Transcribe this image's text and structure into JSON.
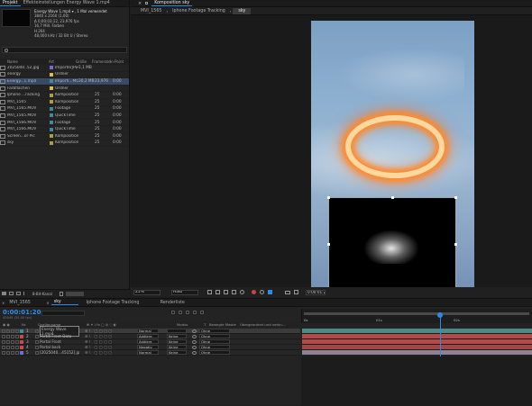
{
  "project": {
    "tabs": [
      "Projekt",
      "Effekteinstellungen Energy Wave 1.mp4"
    ],
    "selected_name": "Energy Wave 1.mp4 ▾ , 1 Mal verwendet",
    "info_lines": [
      "3840 x 2160 (1,00)",
      "Δ 0;00;03;12, 23,976 fps",
      "16,7 Mill. Farben",
      "H.264",
      "48,000 kHz / 32 Bit U / Stereo"
    ],
    "columns": {
      "name": "Name",
      "type": "Art",
      "size": "Größe",
      "fps": "Framerate",
      "in": "In-Point"
    },
    "items": [
      {
        "name": "2025040..52.jpg",
        "type": "ImporterJPEG",
        "size": "1,1 MB",
        "fps": "",
        "in": "",
        "color": "#7a6ad8",
        "sel": false
      },
      {
        "name": "energy",
        "type": "Ordner",
        "size": "",
        "fps": "",
        "in": "",
        "color": "#d8c23a",
        "sel": false
      },
      {
        "name": "Energy...1.mp4",
        "type": "Importi...MOV",
        "size": "30,2 MB",
        "fps": "23,976",
        "in": "0:00",
        "color": "#3f8a9a",
        "sel": true
      },
      {
        "name": "Farbflächen",
        "type": "Ordner",
        "size": "",
        "fps": "",
        "in": "",
        "color": "#d8c23a",
        "sel": false
      },
      {
        "name": "Iphone ...racking",
        "type": "Komposition",
        "size": "",
        "fps": "25",
        "in": "0:00",
        "color": "#a8a03a",
        "sel": false
      },
      {
        "name": "MVI_1565",
        "type": "Komposition",
        "size": "",
        "fps": "25",
        "in": "0:00",
        "color": "#a8a03a",
        "sel": false
      },
      {
        "name": "MVI_1565.MOV",
        "type": "Footage",
        "size": "",
        "fps": "25",
        "in": "0:00",
        "color": "#3f8a9a",
        "sel": false
      },
      {
        "name": "MVI_1565.MOV",
        "type": "QuickTime",
        "size": "",
        "fps": "25",
        "in": "0:00",
        "color": "#3f8a9a",
        "sel": false
      },
      {
        "name": "MVI_1566.MOV",
        "type": "Footage",
        "size": "",
        "fps": "25",
        "in": "0:00",
        "color": "#3f8a9a",
        "sel": false
      },
      {
        "name": "MVI_1566.MOV",
        "type": "QuickTime",
        "size": "",
        "fps": "25",
        "in": "0:00",
        "color": "#3f8a9a",
        "sel": false
      },
      {
        "name": "Screen...or Pic",
        "type": "Komposition",
        "size": "",
        "fps": "25",
        "in": "0:00",
        "color": "#a8a03a",
        "sel": false
      },
      {
        "name": "sky",
        "type": "Komposition",
        "size": "",
        "fps": "25",
        "in": "0:00",
        "color": "#a8a03a",
        "sel": false
      }
    ],
    "bottom_bits": "8-Bit-Kanal"
  },
  "comp": {
    "panel_title": "Komposition sky",
    "tabs": [
      "MVI_1565",
      "Iphone Footage Tracking",
      "sky"
    ],
    "zoom": "25%",
    "resolution": "Halb",
    "timecode": "0:00:01:20"
  },
  "timeline": {
    "tabs": [
      "MVI_1565",
      "sky",
      "Iphone Footage Tracking",
      "Renderliste"
    ],
    "timecode": "0:00:01:20",
    "frames": "00045 (25,00 fps)",
    "columns": {
      "nr": "Nr.",
      "source": "Quellenname",
      "mode": "Modus",
      "t": "T",
      "trkmat": "Bewegte Maske",
      "parent": "Übergeordnet und verkn..."
    },
    "ruler": [
      "0s",
      "01s",
      "02s"
    ],
    "layers": [
      {
        "nr": "1",
        "name": "Energy Wave 1.mp4",
        "mode": "Normal",
        "trk": "",
        "parent": "Ohne",
        "color": "#3f8a9a",
        "bar": "#4e8a86",
        "sel": true
      },
      {
        "nr": "2",
        "name": "Portal Front Data",
        "mode": "Addiere",
        "trk": "Keine",
        "parent": "Ohne",
        "color": "#c84a4a",
        "bar": "#b24a4a",
        "sel": false
      },
      {
        "nr": "3",
        "name": "Portal Front",
        "mode": "Addiere",
        "trk": "Keine",
        "parent": "Ohne",
        "color": "#c84a4a",
        "bar": "#b24a4a",
        "sel": false
      },
      {
        "nr": "4",
        "name": "Portal back",
        "mode": "Negativ",
        "trk": "Keine",
        "parent": "Ohne",
        "color": "#c84a4a",
        "bar": "#a14545",
        "sel": false
      },
      {
        "nr": "5",
        "name": "[2025040...45152].jpg",
        "mode": "Normal",
        "trk": "Keine",
        "parent": "Ohne",
        "color": "#7a6ad8",
        "bar": "#8e8293",
        "sel": false
      }
    ]
  }
}
